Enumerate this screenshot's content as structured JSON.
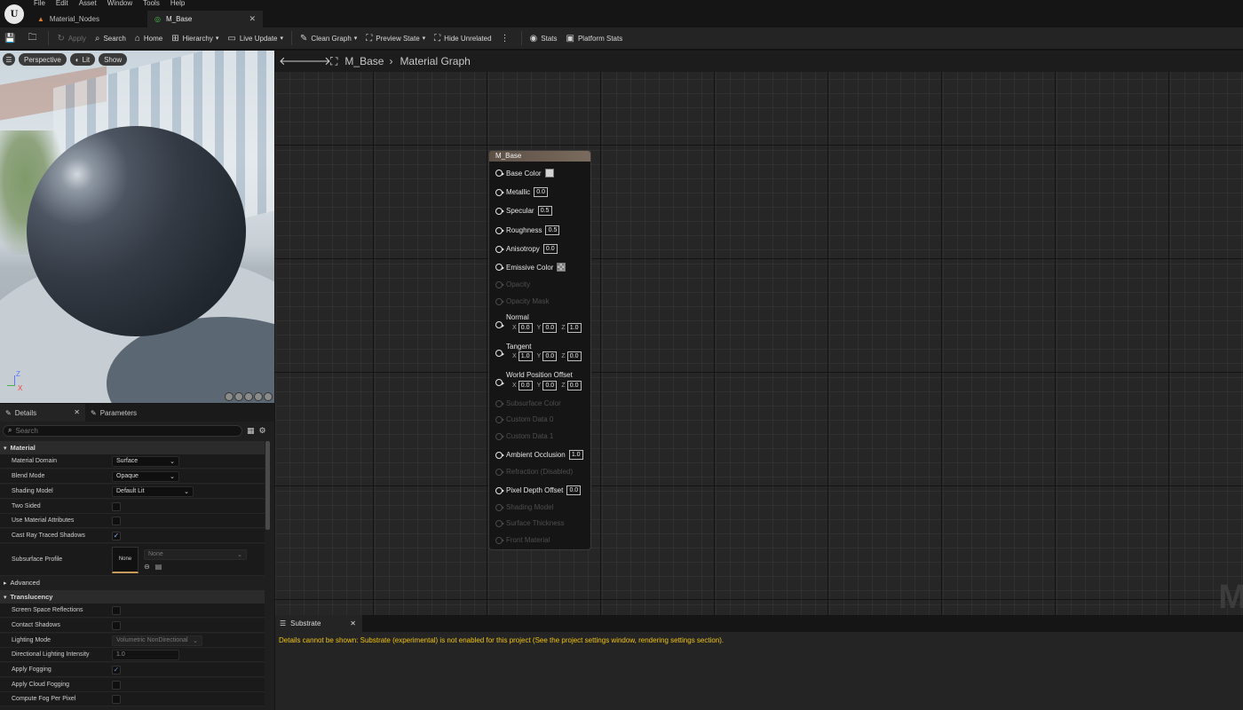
{
  "menu": [
    "File",
    "Edit",
    "Asset",
    "Window",
    "Tools",
    "Help"
  ],
  "tabs": [
    {
      "label": "Material_Nodes"
    },
    {
      "label": "M_Base"
    }
  ],
  "toolbar": {
    "apply": "Apply",
    "search": "Search",
    "home": "Home",
    "hierarchy": "Hierarchy",
    "live_update": "Live Update",
    "clean_graph": "Clean Graph",
    "preview_state": "Preview State",
    "hide_unrelated": "Hide Unrelated",
    "stats": "Stats",
    "platform_stats": "Platform Stats"
  },
  "viewport": {
    "perspective": "Perspective",
    "lit": "Lit",
    "show": "Show",
    "axis_z": "Z",
    "axis_x": "X"
  },
  "details_tabs": {
    "details": "Details",
    "parameters": "Parameters"
  },
  "details": {
    "search_placeholder": "Search",
    "sections": {
      "material": "Material",
      "advanced": "Advanced",
      "translucency": "Translucency"
    },
    "material_domain": {
      "label": "Material Domain",
      "value": "Surface"
    },
    "blend_mode": {
      "label": "Blend Mode",
      "value": "Opaque"
    },
    "shading_model": {
      "label": "Shading Model",
      "value": "Default Lit"
    },
    "two_sided": {
      "label": "Two Sided"
    },
    "use_material_attributes": {
      "label": "Use Material Attributes"
    },
    "cast_ray_traced_shadows": {
      "label": "Cast Ray Traced Shadows"
    },
    "subsurface_profile": {
      "label": "Subsurface Profile",
      "thumb": "None",
      "value": "None"
    },
    "screen_space_reflections": {
      "label": "Screen Space Reflections"
    },
    "contact_shadows": {
      "label": "Contact Shadows"
    },
    "lighting_mode": {
      "label": "Lighting Mode",
      "value": "Volumetric NonDirectional"
    },
    "directional_lighting_intensity": {
      "label": "Directional Lighting Intensity",
      "value": "1.0"
    },
    "apply_fogging": {
      "label": "Apply Fogging"
    },
    "apply_cloud_fogging": {
      "label": "Apply Cloud Fogging"
    },
    "compute_fog_per_pixel": {
      "label": "Compute Fog Per Pixel"
    }
  },
  "graph": {
    "breadcrumb_asset": "M_Base",
    "breadcrumb_graph": "Material Graph",
    "watermark": "M",
    "node": {
      "title": "M_Base",
      "base_color": "Base Color",
      "metallic": "Metallic",
      "metallic_val": "0.0",
      "specular": "Specular",
      "specular_val": "0.5",
      "roughness": "Roughness",
      "roughness_val": "0.5",
      "anisotropy": "Anisotropy",
      "anisotropy_val": "0.0",
      "emissive_color": "Emissive Color",
      "opacity": "Opacity",
      "opacity_mask": "Opacity Mask",
      "normal": "Normal",
      "normal_x": "0.0",
      "normal_y": "0.0",
      "normal_z": "1.0",
      "tangent": "Tangent",
      "tangent_x": "1.0",
      "tangent_y": "0.0",
      "tangent_z": "0.0",
      "wpo": "World Position Offset",
      "wpo_x": "0.0",
      "wpo_y": "0.0",
      "wpo_z": "0.0",
      "subsurface_color": "Subsurface Color",
      "custom_data_0": "Custom Data 0",
      "custom_data_1": "Custom Data 1",
      "ambient_occlusion": "Ambient Occlusion",
      "ambient_occlusion_val": "1.0",
      "refraction": "Refraction (Disabled)",
      "pixel_depth_offset": "Pixel Depth Offset",
      "pixel_depth_offset_val": "0.0",
      "shading_model": "Shading Model",
      "surface_thickness": "Surface Thickness",
      "front_material": "Front Material",
      "axis_x": "X",
      "axis_y": "Y",
      "axis_z": "Z"
    }
  },
  "substrate": {
    "tab": "Substrate",
    "message": "Details cannot be shown: Substrate (experimental) is not enabled for this project (See the project settings window, rendering settings section)."
  },
  "colors": {
    "accent_check": "#8fb6ff",
    "warning_text": "#f1c40f",
    "node_header": "#6b5d51"
  }
}
